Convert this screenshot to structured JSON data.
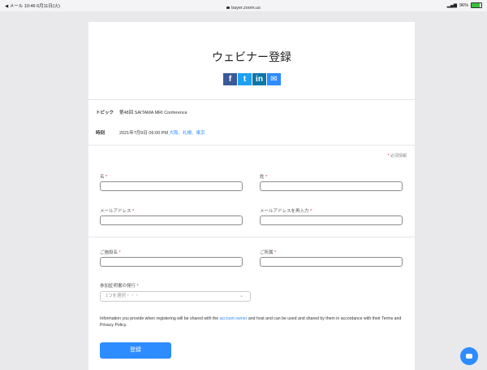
{
  "status_bar": {
    "left": "◀ メール  10:46  6月11日(火)",
    "url": "bayer.zoom.us",
    "right": "96%"
  },
  "page": {
    "title": "ウェビナー登録",
    "share_icons": [
      "facebook-icon",
      "twitter-icon",
      "linkedin-icon",
      "mail-icon"
    ]
  },
  "info": {
    "topic_label": "トピック",
    "topic_value": "第48回 SAITAMA MRI Conference",
    "time_label": "時刻",
    "time_value": "2021年7月9日 06:00 PM",
    "time_zones": "大阪、札幌、東京"
  },
  "form": {
    "required_note": "必須情報",
    "first_name_label": "名",
    "last_name_label": "姓",
    "email_label": "メールアドレス",
    "email_confirm_label": "メールアドレスを再入力",
    "facility_label": "ご施設名",
    "department_label": "ご所属",
    "certificate_label": "参加証明書の発行",
    "certificate_placeholder": "1つを選択・・・"
  },
  "disclaimer": {
    "before": "Information you provide when registering will be shared with the ",
    "link": "account owner",
    "after": " and host and can be used and shared by them in accordance with their Terms and Privacy Policy."
  },
  "register_button": "登録",
  "colors": {
    "accent": "#2d8cff",
    "required": "#e02828"
  }
}
